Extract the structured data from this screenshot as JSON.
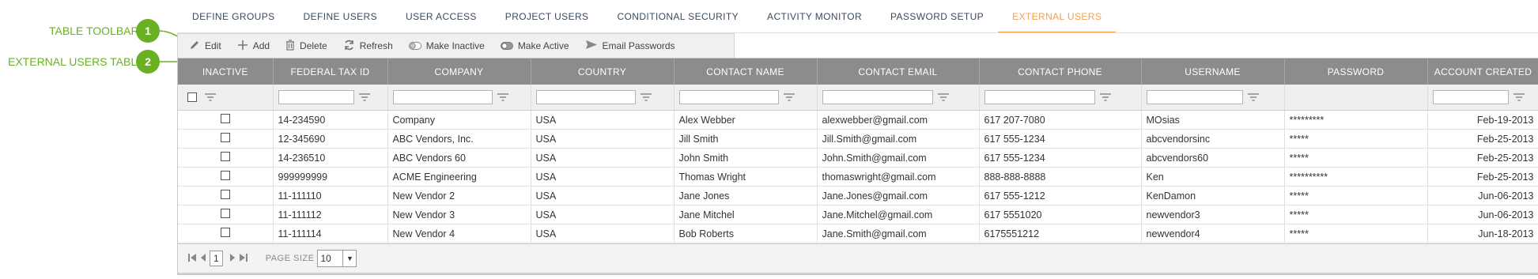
{
  "tabs": [
    {
      "label": "DEFINE GROUPS",
      "active": false
    },
    {
      "label": "DEFINE USERS",
      "active": false
    },
    {
      "label": "USER ACCESS",
      "active": false
    },
    {
      "label": "PROJECT USERS",
      "active": false
    },
    {
      "label": "CONDITIONAL SECURITY",
      "active": false
    },
    {
      "label": "ACTIVITY MONITOR",
      "active": false
    },
    {
      "label": "PASSWORD SETUP",
      "active": false
    },
    {
      "label": "EXTERNAL USERS",
      "active": true
    }
  ],
  "callouts": [
    {
      "number": "1",
      "text": "TABLE TOOLBAR"
    },
    {
      "number": "2",
      "text": "EXTERNAL USERS TABLE"
    }
  ],
  "toolbar": {
    "edit": "Edit",
    "add": "Add",
    "delete": "Delete",
    "refresh": "Refresh",
    "make_inactive": "Make Inactive",
    "make_active": "Make Active",
    "email_passwords": "Email Passwords"
  },
  "table": {
    "columns": [
      "INACTIVE",
      "FEDERAL TAX ID",
      "COMPANY",
      "COUNTRY",
      "CONTACT NAME",
      "CONTACT EMAIL",
      "CONTACT PHONE",
      "USERNAME",
      "PASSWORD",
      "ACCOUNT CREATED"
    ],
    "rows": [
      [
        "",
        "14-234590",
        "Company",
        "USA",
        "Alex Webber",
        "alexwebber@gmail.com",
        "617 207-7080",
        "MOsias",
        "*********",
        "Feb-19-2013"
      ],
      [
        "",
        "12-345690",
        "ABC Vendors, Inc.",
        "USA",
        "Jill Smith",
        "Jill.Smith@gmail.com",
        "617 555-1234",
        "abcvendorsinc",
        "*****",
        "Feb-25-2013"
      ],
      [
        "",
        "14-236510",
        "ABC Vendors 60",
        "USA",
        "John Smith",
        "John.Smith@gmail.com",
        "617 555-1234",
        "abcvendors60",
        "*****",
        "Feb-25-2013"
      ],
      [
        "",
        "999999999",
        "ACME Engineering",
        "USA",
        "Thomas Wright",
        "thomaswright@gmail.com",
        "888-888-8888",
        "Ken",
        "**********",
        "Feb-25-2013"
      ],
      [
        "",
        "11-111110",
        "New Vendor 2",
        "USA",
        "Jane Jones",
        "Jane.Jones@gmail.com",
        "617 555-1212",
        "KenDamon",
        "*****",
        "Jun-06-2013"
      ],
      [
        "",
        "11-111112",
        "New Vendor 3",
        "USA",
        "Jane Mitchel",
        "Jane.Mitchel@gmail.com",
        "617 5551020",
        "newvendor3",
        "*****",
        "Jun-06-2013"
      ],
      [
        "",
        "11-111114",
        "New Vendor 4",
        "USA",
        "Bob Roberts",
        "Jane.Smith@gmail.com",
        "6175551212",
        "newvendor4",
        "*****",
        "Jun-18-2013"
      ]
    ]
  },
  "pager": {
    "current_page": "1",
    "page_size_label": "PAGE SIZE",
    "page_size": "10"
  },
  "colors": {
    "accent": "#f0a050",
    "callout": "#6ab023",
    "header_bg": "#8c8c8c"
  }
}
